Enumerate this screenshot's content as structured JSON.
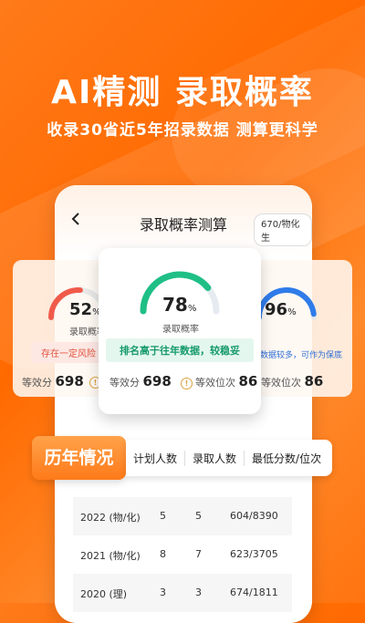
{
  "headline": "AI精测  录取概率",
  "subline": "收录30省近5年招录数据  测算更科学",
  "screen": {
    "back_icon": "chevron-left-icon",
    "title": "录取概率测算",
    "score_chip": "670/物化生"
  },
  "cards": {
    "left": {
      "percent": "52",
      "percent_unit": "%",
      "label": "录取概率",
      "tag": "存在一定风险",
      "stat1_label": "等效分",
      "stat1_value": "698",
      "gauge_value": 0.52,
      "color": "#f05a4a"
    },
    "center": {
      "percent": "78",
      "percent_unit": "%",
      "label": "录取概率",
      "tag": "排名高于往年数据，较稳妥",
      "stat1_label": "等效分",
      "stat1_value": "698",
      "stat2_label": "等效位次",
      "stat2_value": "86",
      "gauge_value": 0.78,
      "color": "#1fbf86"
    },
    "right": {
      "percent": "96",
      "percent_unit": "%",
      "tag": "数据较多，可作为保底",
      "stat2_label": "等效位次",
      "stat2_value": "86",
      "gauge_value": 0.96,
      "color": "#2f7bea"
    }
  },
  "history": {
    "label": "历年情况",
    "columns": [
      "计划人数",
      "录取人数",
      "最低分数/位次"
    ],
    "rows": [
      {
        "year": "2022 (物/化)",
        "plan": "5",
        "admit": "5",
        "min": "604/8390"
      },
      {
        "year": "2021 (物/化)",
        "plan": "8",
        "admit": "7",
        "min": "623/3705"
      },
      {
        "year": "2020 (理)",
        "plan": "3",
        "admit": "3",
        "min": "674/1811"
      }
    ]
  },
  "colors": {
    "accent": "#ff7a1a",
    "good": "#1fbf86",
    "risk": "#f05a4a",
    "safe": "#2f7bea"
  }
}
